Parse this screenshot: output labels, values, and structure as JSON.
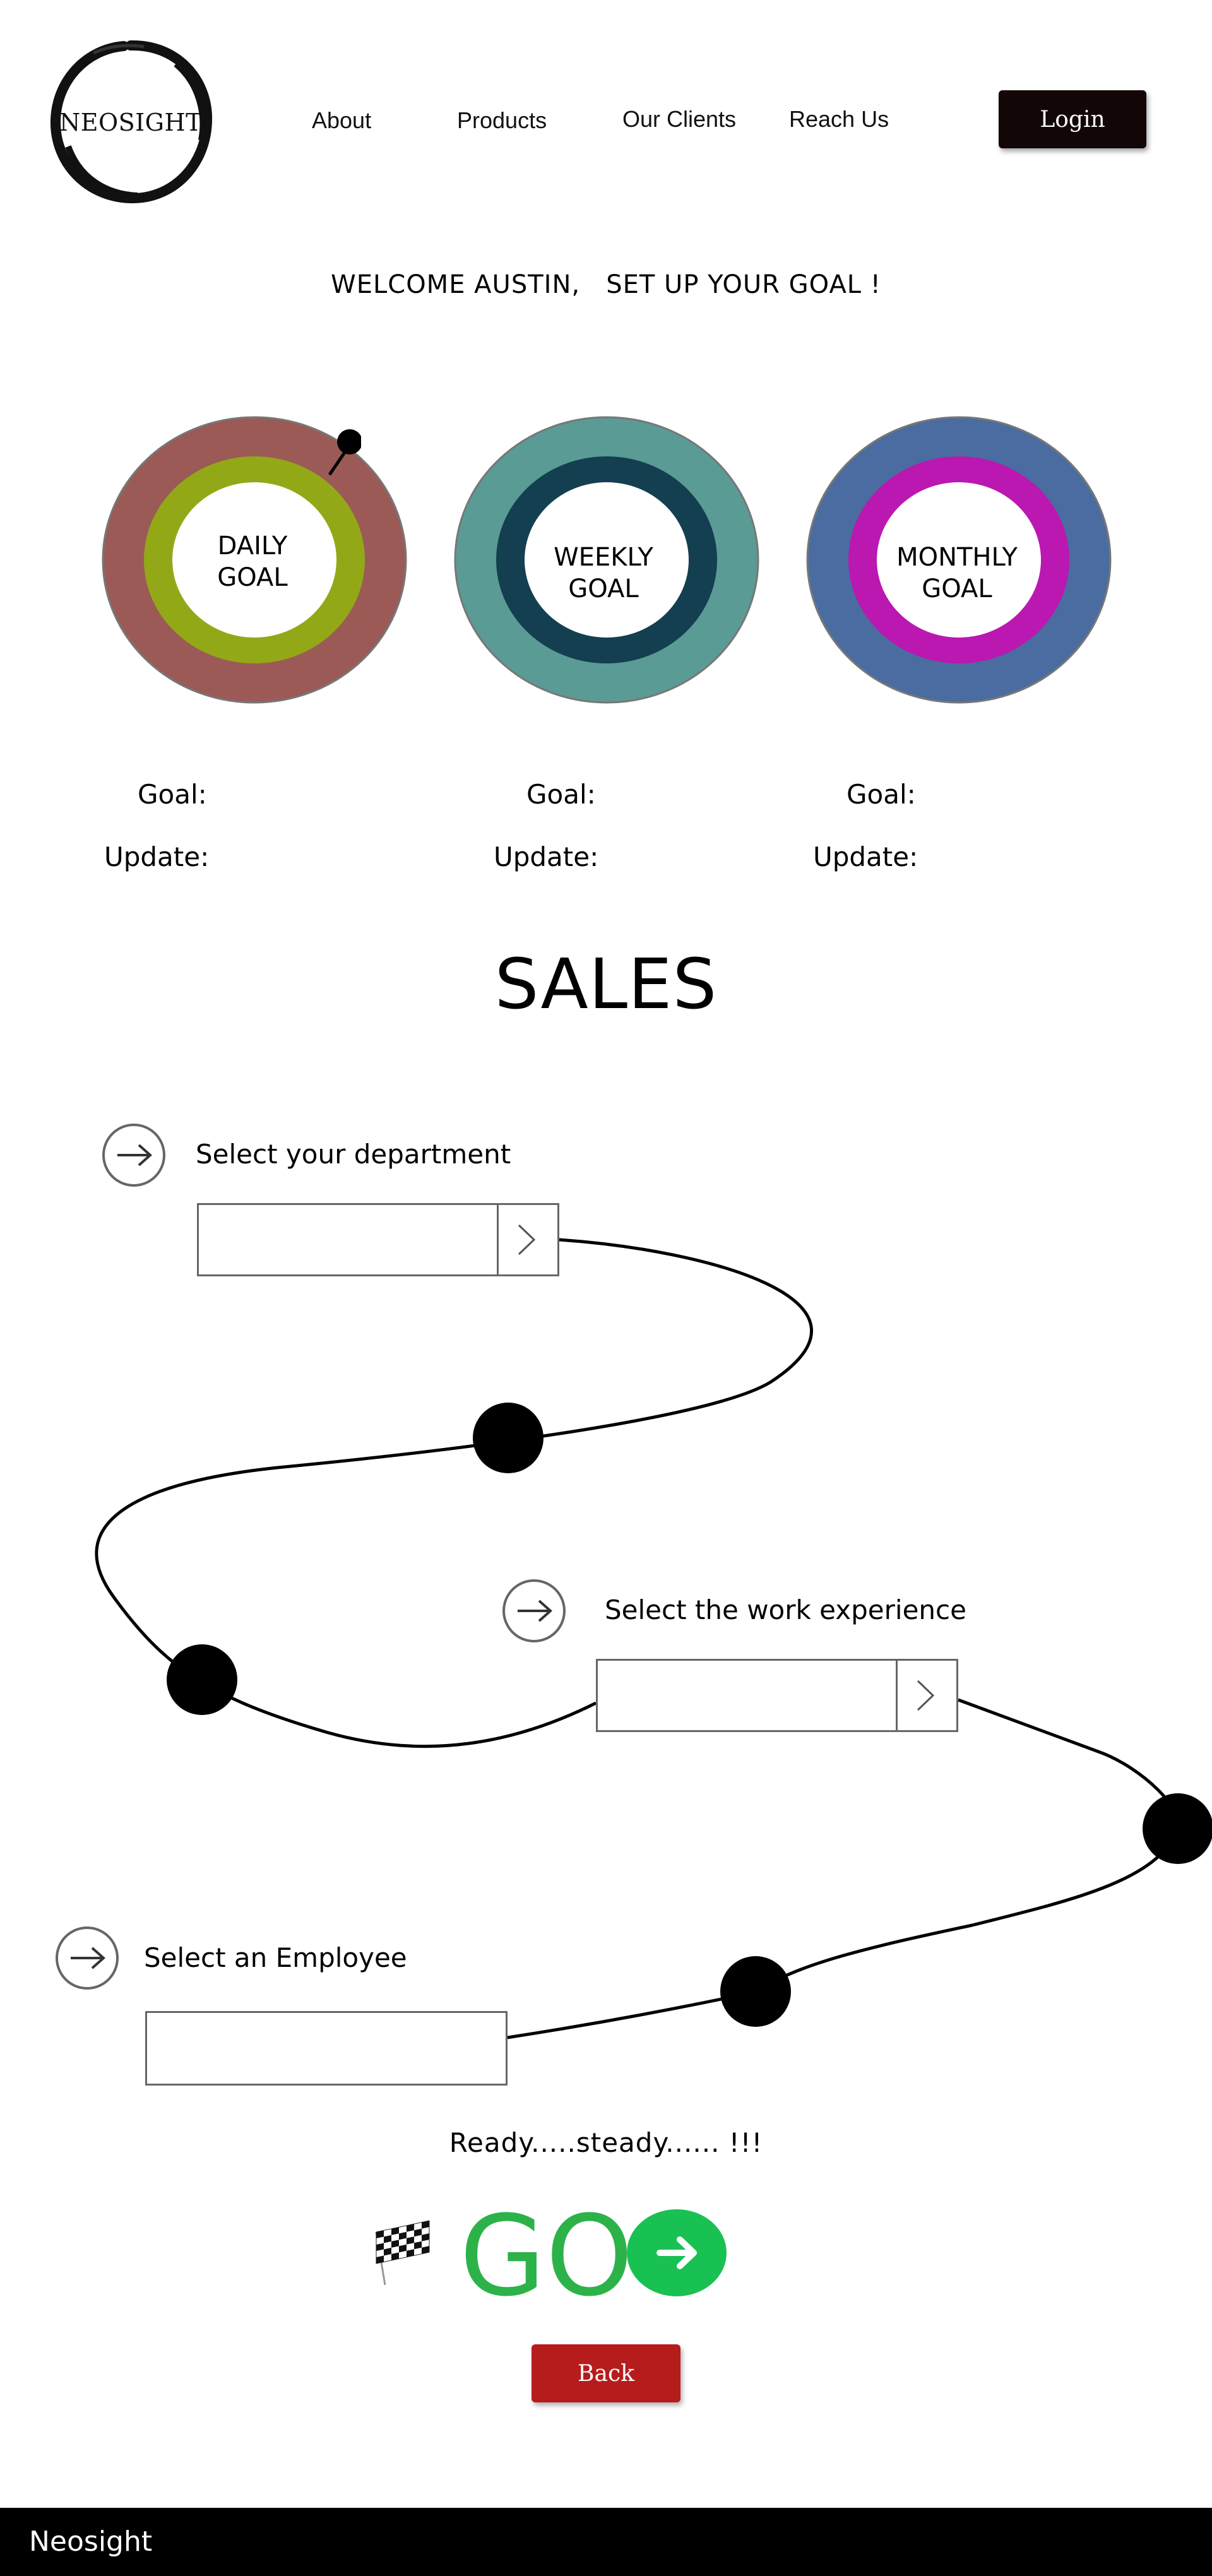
{
  "header": {
    "logo_text": "NEOSIGHT",
    "nav": [
      {
        "label": "About"
      },
      {
        "label": "Products"
      },
      {
        "label": "Our Clients"
      },
      {
        "label": "Reach Us"
      }
    ],
    "login_label": "Login"
  },
  "welcome": "WELCOME AUSTIN,   SET UP YOUR GOAL !",
  "goals": [
    {
      "label_line1": "DAILY",
      "label_line2": "GOAL",
      "goal_label": "Goal:",
      "update_label": "Update:",
      "colors": {
        "outer": "#9b5a56",
        "middle": "#93a816",
        "inner": "#ffffff"
      },
      "icon": "pin-icon"
    },
    {
      "label_line1": "WEEKLY",
      "label_line2": "GOAL",
      "goal_label": "Goal:",
      "update_label": "Update:",
      "colors": {
        "outer": "#5a9b95",
        "middle": "#143f50",
        "inner": "#ffffff"
      }
    },
    {
      "label_line1": "MONTHLY",
      "label_line2": "GOAL",
      "goal_label": "Goal:",
      "update_label": "Update:",
      "colors": {
        "outer": "#4a6ca0",
        "middle": "#bb17b1",
        "inner": "#ffffff"
      }
    }
  ],
  "section_title": "SALES",
  "steps": [
    {
      "label": "Select your department",
      "value": "",
      "icon": "arrow-right-icon",
      "has_button": true
    },
    {
      "label": "Select the work experience",
      "value": "",
      "icon": "arrow-right-icon",
      "has_button": true
    },
    {
      "label": "Select an Employee",
      "value": "",
      "icon": "arrow-right-icon",
      "has_button": false
    }
  ],
  "ready_text": "Ready.....steady...... !!!",
  "go_label": "GO",
  "back_label": "Back",
  "footer_text": "Neosight",
  "colors": {
    "go_green": "#2db24a",
    "go_button": "#19c153",
    "back_red": "#b71c1c",
    "login_bg": "#120606"
  }
}
